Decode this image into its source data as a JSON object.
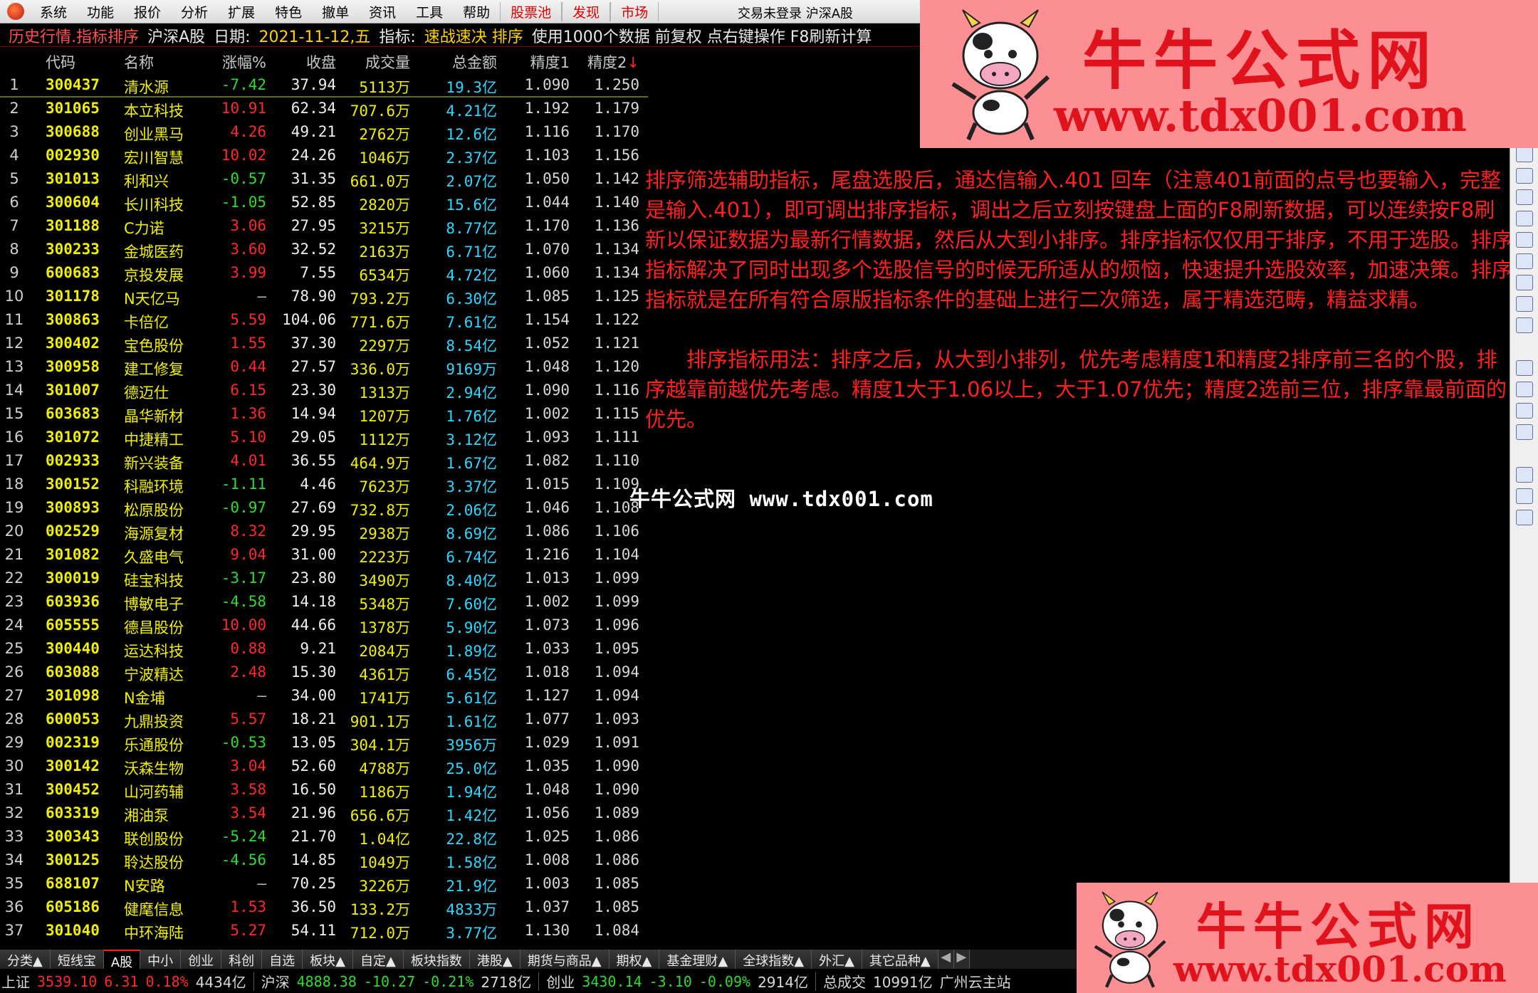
{
  "menu": {
    "items": [
      "系统",
      "功能",
      "报价",
      "分析",
      "扩展",
      "特色",
      "撤单",
      "资讯",
      "工具",
      "帮助"
    ],
    "hot_items": [
      "股票池",
      "发现",
      "市场"
    ],
    "trade_status": "交易未登录  沪深A股"
  },
  "titlebar": {
    "view": "历史行情.指标排序",
    "market": "沪深A股",
    "date_label": "日期:",
    "date": "2021-11-12,五",
    "indicator_label": "指标:",
    "indicator": "速战速决 排序",
    "hint": "使用1000个数据 前复权 点右键操作 F8刷新计算"
  },
  "columns": {
    "code": "代码",
    "name": "名称",
    "chg": "涨幅%",
    "close": "收盘",
    "vol": "成交量",
    "amt": "总金额",
    "p1": "精度1",
    "p2": "精度2",
    "sort_arrow": "↓"
  },
  "rows": [
    {
      "i": "1",
      "code": "300437",
      "name": "清水源",
      "chg": "-7.42",
      "close": "37.94",
      "vol": "5113万",
      "amt": "19.3亿",
      "p1": "1.090",
      "p2": "1.250",
      "dir": "down"
    },
    {
      "i": "2",
      "code": "301065",
      "name": "本立科技",
      "chg": "10.91",
      "close": "62.34",
      "vol": "707.6万",
      "amt": "4.21亿",
      "p1": "1.192",
      "p2": "1.179",
      "dir": "up"
    },
    {
      "i": "3",
      "code": "300688",
      "name": "创业黑马",
      "chg": "4.26",
      "close": "49.21",
      "vol": "2762万",
      "amt": "12.6亿",
      "p1": "1.116",
      "p2": "1.170",
      "dir": "up"
    },
    {
      "i": "4",
      "code": "002930",
      "name": "宏川智慧",
      "chg": "10.02",
      "close": "24.26",
      "vol": "1046万",
      "amt": "2.37亿",
      "p1": "1.103",
      "p2": "1.156",
      "dir": "up"
    },
    {
      "i": "5",
      "code": "301013",
      "name": "利和兴",
      "chg": "-0.57",
      "close": "31.35",
      "vol": "661.0万",
      "amt": "2.07亿",
      "p1": "1.050",
      "p2": "1.142",
      "dir": "down"
    },
    {
      "i": "6",
      "code": "300604",
      "name": "长川科技",
      "chg": "-1.05",
      "close": "52.85",
      "vol": "2820万",
      "amt": "15.6亿",
      "p1": "1.044",
      "p2": "1.140",
      "dir": "down"
    },
    {
      "i": "7",
      "code": "301188",
      "name": "C力诺",
      "chg": "3.06",
      "close": "27.95",
      "vol": "3215万",
      "amt": "8.77亿",
      "p1": "1.170",
      "p2": "1.136",
      "dir": "up"
    },
    {
      "i": "8",
      "code": "300233",
      "name": "金城医药",
      "chg": "3.60",
      "close": "32.52",
      "vol": "2163万",
      "amt": "6.71亿",
      "p1": "1.070",
      "p2": "1.134",
      "dir": "up"
    },
    {
      "i": "9",
      "code": "600683",
      "name": "京投发展",
      "chg": "3.99",
      "close": "7.55",
      "vol": "6534万",
      "amt": "4.72亿",
      "p1": "1.060",
      "p2": "1.134",
      "dir": "up"
    },
    {
      "i": "10",
      "code": "301178",
      "name": "N天亿马",
      "chg": "—",
      "close": "78.90",
      "vol": "793.2万",
      "amt": "6.30亿",
      "p1": "1.085",
      "p2": "1.125",
      "dir": "flat"
    },
    {
      "i": "11",
      "code": "300863",
      "name": "卡倍亿",
      "chg": "5.59",
      "close": "104.06",
      "vol": "771.6万",
      "amt": "7.61亿",
      "p1": "1.154",
      "p2": "1.122",
      "dir": "up"
    },
    {
      "i": "12",
      "code": "300402",
      "name": "宝色股份",
      "chg": "1.55",
      "close": "37.30",
      "vol": "2297万",
      "amt": "8.54亿",
      "p1": "1.052",
      "p2": "1.121",
      "dir": "up"
    },
    {
      "i": "13",
      "code": "300958",
      "name": "建工修复",
      "chg": "0.44",
      "close": "27.57",
      "vol": "336.0万",
      "amt": "9169万",
      "p1": "1.048",
      "p2": "1.120",
      "dir": "up"
    },
    {
      "i": "14",
      "code": "301007",
      "name": "德迈仕",
      "chg": "6.15",
      "close": "23.30",
      "vol": "1313万",
      "amt": "2.94亿",
      "p1": "1.090",
      "p2": "1.116",
      "dir": "up"
    },
    {
      "i": "15",
      "code": "603683",
      "name": "晶华新材",
      "chg": "1.36",
      "close": "14.94",
      "vol": "1207万",
      "amt": "1.76亿",
      "p1": "1.002",
      "p2": "1.115",
      "dir": "up"
    },
    {
      "i": "16",
      "code": "301072",
      "name": "中捷精工",
      "chg": "5.10",
      "close": "29.05",
      "vol": "1112万",
      "amt": "3.12亿",
      "p1": "1.093",
      "p2": "1.111",
      "dir": "up"
    },
    {
      "i": "17",
      "code": "002933",
      "name": "新兴装备",
      "chg": "4.01",
      "close": "36.55",
      "vol": "464.9万",
      "amt": "1.67亿",
      "p1": "1.082",
      "p2": "1.110",
      "dir": "up"
    },
    {
      "i": "18",
      "code": "300152",
      "name": "科融环境",
      "chg": "-1.11",
      "close": "4.46",
      "vol": "7623万",
      "amt": "3.37亿",
      "p1": "1.015",
      "p2": "1.109",
      "dir": "down"
    },
    {
      "i": "19",
      "code": "300893",
      "name": "松原股份",
      "chg": "-0.97",
      "close": "27.69",
      "vol": "732.8万",
      "amt": "2.06亿",
      "p1": "1.046",
      "p2": "1.108",
      "dir": "down"
    },
    {
      "i": "20",
      "code": "002529",
      "name": "海源复材",
      "chg": "8.32",
      "close": "29.95",
      "vol": "2938万",
      "amt": "8.69亿",
      "p1": "1.086",
      "p2": "1.106",
      "dir": "up"
    },
    {
      "i": "21",
      "code": "301082",
      "name": "久盛电气",
      "chg": "9.04",
      "close": "31.00",
      "vol": "2223万",
      "amt": "6.74亿",
      "p1": "1.216",
      "p2": "1.104",
      "dir": "up"
    },
    {
      "i": "22",
      "code": "300019",
      "name": "硅宝科技",
      "chg": "-3.17",
      "close": "23.80",
      "vol": "3490万",
      "amt": "8.40亿",
      "p1": "1.013",
      "p2": "1.099",
      "dir": "down"
    },
    {
      "i": "23",
      "code": "603936",
      "name": "博敏电子",
      "chg": "-4.58",
      "close": "14.18",
      "vol": "5348万",
      "amt": "7.60亿",
      "p1": "1.002",
      "p2": "1.099",
      "dir": "down"
    },
    {
      "i": "24",
      "code": "605555",
      "name": "德昌股份",
      "chg": "10.00",
      "close": "44.66",
      "vol": "1378万",
      "amt": "5.90亿",
      "p1": "1.073",
      "p2": "1.096",
      "dir": "up"
    },
    {
      "i": "25",
      "code": "300440",
      "name": "运达科技",
      "chg": "0.88",
      "close": "9.21",
      "vol": "2084万",
      "amt": "1.89亿",
      "p1": "1.033",
      "p2": "1.095",
      "dir": "up"
    },
    {
      "i": "26",
      "code": "603088",
      "name": "宁波精达",
      "chg": "2.48",
      "close": "15.30",
      "vol": "4361万",
      "amt": "6.45亿",
      "p1": "1.018",
      "p2": "1.094",
      "dir": "up"
    },
    {
      "i": "27",
      "code": "301098",
      "name": "N金埔",
      "chg": "—",
      "close": "34.00",
      "vol": "1741万",
      "amt": "5.61亿",
      "p1": "1.127",
      "p2": "1.094",
      "dir": "flat"
    },
    {
      "i": "28",
      "code": "600053",
      "name": "九鼎投资",
      "chg": "5.57",
      "close": "18.21",
      "vol": "901.1万",
      "amt": "1.61亿",
      "p1": "1.077",
      "p2": "1.093",
      "dir": "up"
    },
    {
      "i": "29",
      "code": "002319",
      "name": "乐通股份",
      "chg": "-0.53",
      "close": "13.05",
      "vol": "304.1万",
      "amt": "3956万",
      "p1": "1.029",
      "p2": "1.091",
      "dir": "down"
    },
    {
      "i": "30",
      "code": "300142",
      "name": "沃森生物",
      "chg": "3.04",
      "close": "52.60",
      "vol": "4788万",
      "amt": "25.0亿",
      "p1": "1.035",
      "p2": "1.090",
      "dir": "up"
    },
    {
      "i": "31",
      "code": "300452",
      "name": "山河药辅",
      "chg": "3.58",
      "close": "16.50",
      "vol": "1186万",
      "amt": "1.94亿",
      "p1": "1.048",
      "p2": "1.090",
      "dir": "up"
    },
    {
      "i": "32",
      "code": "603319",
      "name": "湘油泵",
      "chg": "3.54",
      "close": "21.96",
      "vol": "656.6万",
      "amt": "1.42亿",
      "p1": "1.056",
      "p2": "1.089",
      "dir": "up"
    },
    {
      "i": "33",
      "code": "300343",
      "name": "联创股份",
      "chg": "-5.24",
      "close": "21.70",
      "vol": "1.04亿",
      "amt": "22.8亿",
      "p1": "1.025",
      "p2": "1.086",
      "dir": "down"
    },
    {
      "i": "34",
      "code": "300125",
      "name": "聆达股份",
      "chg": "-4.56",
      "close": "14.85",
      "vol": "1049万",
      "amt": "1.58亿",
      "p1": "1.008",
      "p2": "1.086",
      "dir": "down"
    },
    {
      "i": "35",
      "code": "688107",
      "name": "N安路",
      "chg": "—",
      "close": "70.25",
      "vol": "3226万",
      "amt": "21.9亿",
      "p1": "1.003",
      "p2": "1.085",
      "dir": "flat"
    },
    {
      "i": "36",
      "code": "605186",
      "name": "健麾信息",
      "chg": "1.53",
      "close": "36.50",
      "vol": "133.2万",
      "amt": "4833万",
      "p1": "1.037",
      "p2": "1.085",
      "dir": "up"
    },
    {
      "i": "37",
      "code": "301040",
      "name": "中环海陆",
      "chg": "5.27",
      "close": "54.11",
      "vol": "712.0万",
      "amt": "3.77亿",
      "p1": "1.130",
      "p2": "1.084",
      "dir": "up"
    }
  ],
  "notes": {
    "para1": "排序筛选辅助指标，尾盘选股后，通达信输入.401 回车（注意401前面的点号也要输入，完整是输入.401），即可调出排序指标，调出之后立刻按键盘上面的F8刷新数据，可以连续按F8刷新以保证数据为最新行情数据，然后从大到小排序。排序指标仅仅用于排序，不用于选股。排序指标解决了同时出现多个选股信号的时候无所适从的烦恼，快速提升选股效率，加速决策。排序指标就是在所有符合原版指标条件的基础上进行二次筛选，属于精选范畴，精益求精。",
    "para2": "排序指标用法：排序之后，从大到小排列，优先考虑精度1和精度2排序前三名的个股，排序越靠前越优先考虑。精度1大于1.06以上，大于1.07优先；精度2选前三位，排序靠最前面的优先。",
    "watermark": "牛牛公式网 www.tdx001.com"
  },
  "banner": {
    "title": "牛牛公式网",
    "url": "www.tdx001.com",
    "colors": {
      "background": "#fb8f94",
      "text": "#e0121c"
    }
  },
  "tabs": [
    "分类▲",
    "短线宝",
    "A股",
    "中小",
    "创业",
    "科创",
    "自选",
    "板块▲",
    "自定▲",
    "板块指数",
    "港股▲",
    "期货与商品▲",
    "期权▲",
    "基金理财▲",
    "全球指数▲",
    "外汇▲",
    "其它品种▲"
  ],
  "active_tab": "A股",
  "status": {
    "sh_name": "上证",
    "sh_val": "3539.10",
    "sh_chg": "6.31",
    "sh_pct": "0.18%",
    "sh_amt": "4434亿",
    "hs_name": "沪深",
    "hs_val": "4888.38",
    "hs_chg": "-10.27",
    "hs_pct": "-0.21%",
    "hs_amt": "2718亿",
    "cy_name": "创业",
    "cy_val": "3430.14",
    "cy_chg": "-3.10",
    "cy_pct": "-0.09%",
    "cy_amt": "2914亿",
    "total_label": "总成交",
    "total_val": "10991亿",
    "server": "广州云主站"
  },
  "colors": {
    "up": "#ff2828",
    "down": "#2edc2e",
    "code": "#f0f000",
    "amount": "#2fd7ff",
    "note": "#ff2020"
  }
}
